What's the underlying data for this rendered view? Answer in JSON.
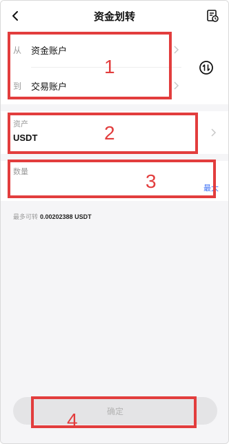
{
  "header": {
    "title": "资金划转",
    "back_icon": "chevron-left-icon",
    "history_icon": "transfer-history-icon"
  },
  "transfer": {
    "from_label": "从",
    "from_account": "资金账户",
    "to_label": "到",
    "to_account": "交易账户",
    "swap_icon": "swap-icon"
  },
  "asset": {
    "label": "资产",
    "value": "USDT"
  },
  "amount": {
    "label": "数量",
    "placeholder": "",
    "max_label": "最大"
  },
  "available": {
    "label": "最多可转",
    "value": "0.00202388 USDT"
  },
  "confirm": {
    "label": "确定"
  },
  "annotations": {
    "box1": "1",
    "box2": "2",
    "box3": "3",
    "box4": "4"
  },
  "colors": {
    "accent": "#3b6ff5",
    "annotation": "#e23d3d",
    "background": "#f5f5f7",
    "disabled_button": "#e4e4e6"
  }
}
